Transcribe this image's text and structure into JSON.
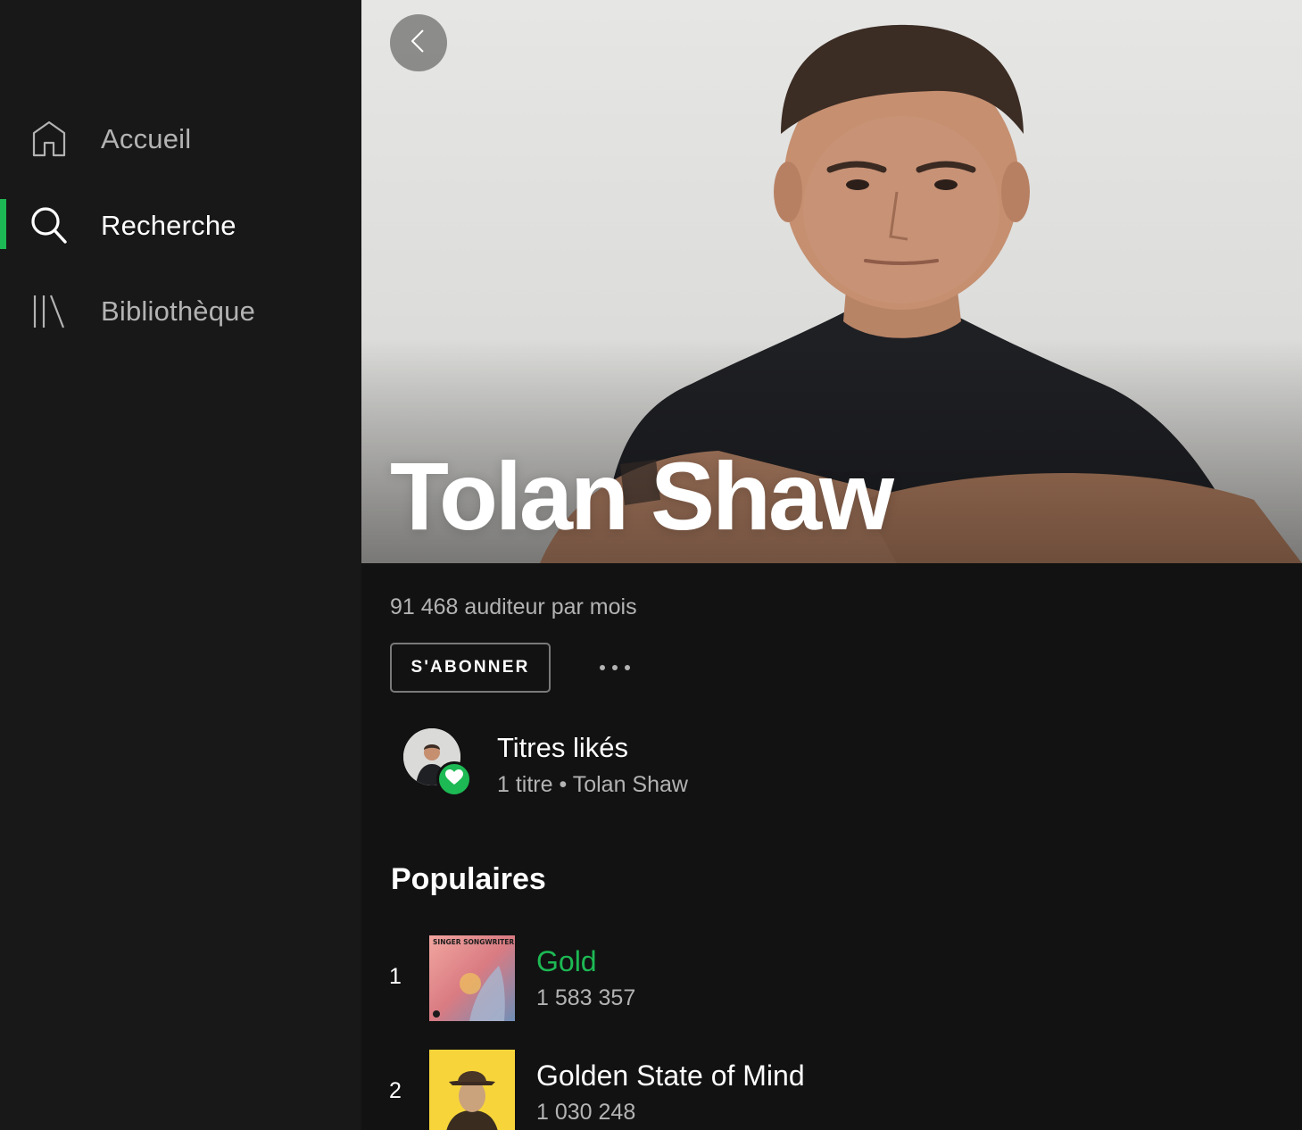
{
  "colors": {
    "accent": "#1db954",
    "sidebar_bg": "#181818",
    "main_bg": "#121212",
    "text_secondary": "#b3b3b3"
  },
  "sidebar": {
    "items": [
      {
        "label": "Accueil",
        "icon": "home-icon",
        "active": false
      },
      {
        "label": "Recherche",
        "icon": "search-icon",
        "active": true
      },
      {
        "label": "Bibliothèque",
        "icon": "library-icon",
        "active": false
      }
    ]
  },
  "artist": {
    "name": "Tolan Shaw",
    "listeners": "91 468 auditeur par mois",
    "follow_label": "S'ABONNER",
    "more_icon": "more-horizontal-icon",
    "back_icon": "chevron-left-icon"
  },
  "liked": {
    "title": "Titres likés",
    "subtitle": "1 titre • Tolan Shaw",
    "badge_icon": "heart-icon"
  },
  "popular": {
    "title": "Populaires",
    "tracks": [
      {
        "number": "1",
        "title": "Gold",
        "plays": "1 583 357",
        "playing": true,
        "cover_text": "SINGER SONGWRITER INDIE POP"
      },
      {
        "number": "2",
        "title": "Golden State of Mind",
        "plays": "1 030 248",
        "playing": false
      }
    ]
  }
}
